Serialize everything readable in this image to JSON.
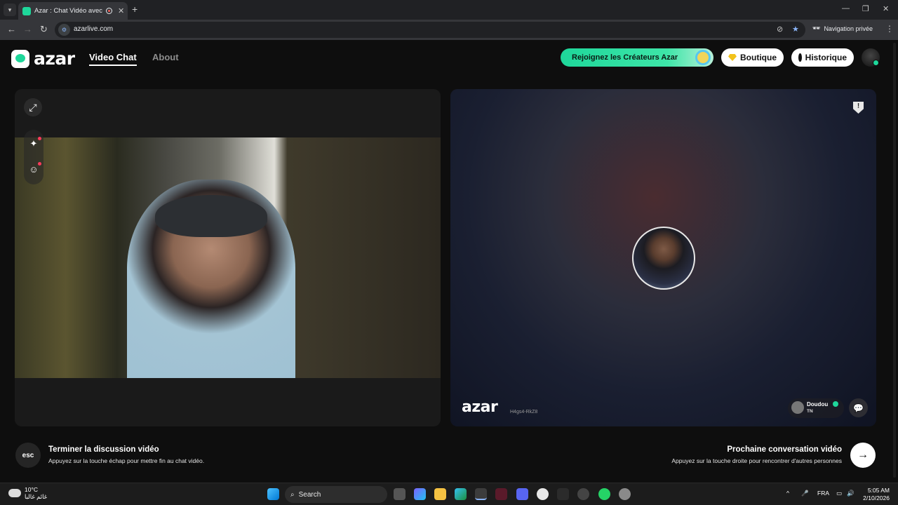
{
  "browser": {
    "tab_title": "Azar : Chat Vidéo avec de n",
    "url": "azarlive.com",
    "private_label": "Navigation privée"
  },
  "header": {
    "brand": "azar",
    "nav": [
      {
        "label": "Video Chat",
        "active": true
      },
      {
        "label": "About",
        "active": false
      }
    ],
    "creators_button": "Rejoignez les Créateurs Azar",
    "shop_button": "Boutique",
    "history_button": "Historique"
  },
  "partner": {
    "watermark": "azar",
    "session_id": "H4gs4-RkZ8",
    "name": "Doudou",
    "country": "TN"
  },
  "footer": {
    "esc_key": "esc",
    "end_title": "Terminer la discussion vidéo",
    "end_hint": "Appuyez sur la touche échap pour mettre fin au chat vidéo.",
    "next_title": "Prochaine conversation vidéo",
    "next_hint": "Appuyez sur la touche droite pour rencontrer d'autres personnes"
  },
  "taskbar": {
    "temperature": "10°C",
    "weather_text": "غائم غالبا",
    "search_label": "Search",
    "language": "FRA",
    "time": "5:05 AM",
    "date": "2/10/2026"
  },
  "colors": {
    "accent": "#1ed79a",
    "background": "#0e0e0e",
    "panel": "#1a1a1a"
  },
  "icons": [
    "expand-icon",
    "magic-wand-icon",
    "sticker-icon",
    "report-shield-icon",
    "chat-bubble-icon",
    "arrow-right-icon"
  ]
}
